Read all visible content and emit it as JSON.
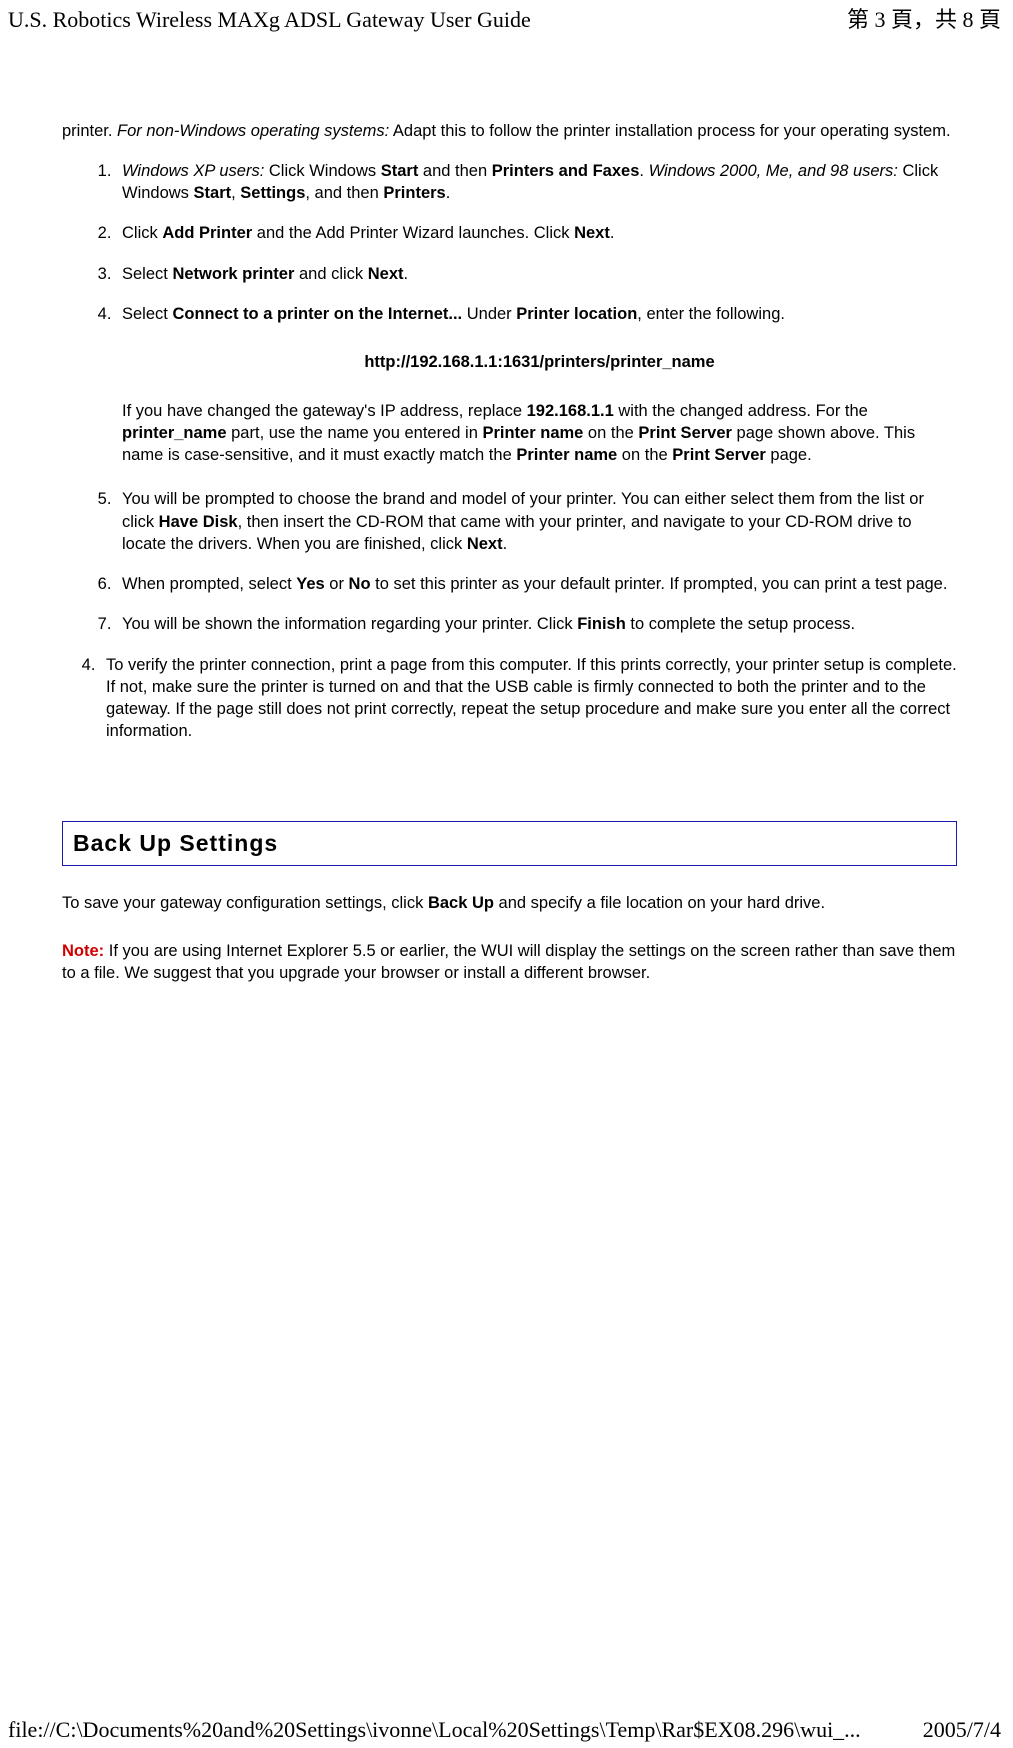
{
  "header": {
    "title": "U.S. Robotics Wireless MAXg ADSL Gateway User Guide",
    "page_indicator": "第 3 頁，共 8 頁"
  },
  "intro": {
    "prefix": "printer. ",
    "italic": "For non-Windows operating systems:",
    "suffix": " Adapt this to follow the printer installation process for your operating system."
  },
  "nested": {
    "item1": {
      "i1": "Windows XP users:",
      "t1": " Click Windows ",
      "b1": "Start",
      "t2": " and then ",
      "b2": "Printers and Faxes",
      "t3": ". ",
      "i2": "Windows 2000, Me, and 98 users:",
      "t4": " Click Windows ",
      "b3": "Start",
      "t5": ", ",
      "b4": "Settings",
      "t6": ", and then ",
      "b5": "Printers",
      "t7": "."
    },
    "item2": {
      "t1": "Click ",
      "b1": "Add Printer",
      "t2": " and the Add Printer Wizard launches. Click ",
      "b2": "Next",
      "t3": "."
    },
    "item3": {
      "t1": "Select ",
      "b1": "Network printer",
      "t2": " and click ",
      "b2": "Next",
      "t3": "."
    },
    "item4": {
      "t1": "Select ",
      "b1": "Connect to a printer on the Internet...",
      "t2": " Under ",
      "b2": "Printer location",
      "t3": ", enter the following.",
      "url": "http://192.168.1.1:1631/printers/printer_name",
      "follow_t1": "If you have changed the gateway's IP address, replace ",
      "follow_b1": "192.168.1.1",
      "follow_t2": " with the changed address. For the ",
      "follow_b2": "printer_name",
      "follow_t3": " part, use the name you entered in ",
      "follow_b3": "Printer name",
      "follow_t4": " on the ",
      "follow_b4": "Print Server",
      "follow_t5": " page shown above. This name is case-sensitive, and it must exactly match the ",
      "follow_b5": "Printer name",
      "follow_t6": " on the ",
      "follow_b6": "Print Server",
      "follow_t7": " page."
    },
    "item5": {
      "t1": "You will be prompted to choose the brand and model of your printer. You can either select them from the list or click ",
      "b1": "Have Disk",
      "t2": ", then insert the CD-ROM that came with your printer, and navigate to your CD-ROM drive to locate the drivers. When you are finished, click ",
      "b2": "Next",
      "t3": "."
    },
    "item6": {
      "t1": "When prompted, select ",
      "b1": "Yes",
      "t2": " or ",
      "b2": "No",
      "t3": " to set this printer as your default printer. If prompted, you can print a test page."
    },
    "item7": {
      "t1": "You will be shown the information regarding your printer. Click ",
      "b1": "Finish",
      "t2": " to complete the setup process."
    }
  },
  "outer": {
    "item4": "To verify the printer connection, print a page from this computer. If this prints correctly, your printer setup is complete. If not, make sure the printer is turned on and that the USB cable is firmly connected to both the printer and to the gateway. If the page still does not print correctly, repeat the setup procedure and make sure you enter all the correct information."
  },
  "section": {
    "heading": "Back Up Settings",
    "para1_t1": "To save your gateway configuration settings, click ",
    "para1_b1": "Back Up",
    "para1_t2": " and specify a file location on your hard drive.",
    "note_label": "Note:",
    "note_text": " If you are using Internet Explorer 5.5 or earlier, the WUI will display the settings on the screen rather than save them to a file. We suggest that you upgrade your browser or install a different browser."
  },
  "footer": {
    "path": "file://C:\\Documents%20and%20Settings\\ivonne\\Local%20Settings\\Temp\\Rar$EX08.296\\wui_...",
    "date": "2005/7/4"
  }
}
